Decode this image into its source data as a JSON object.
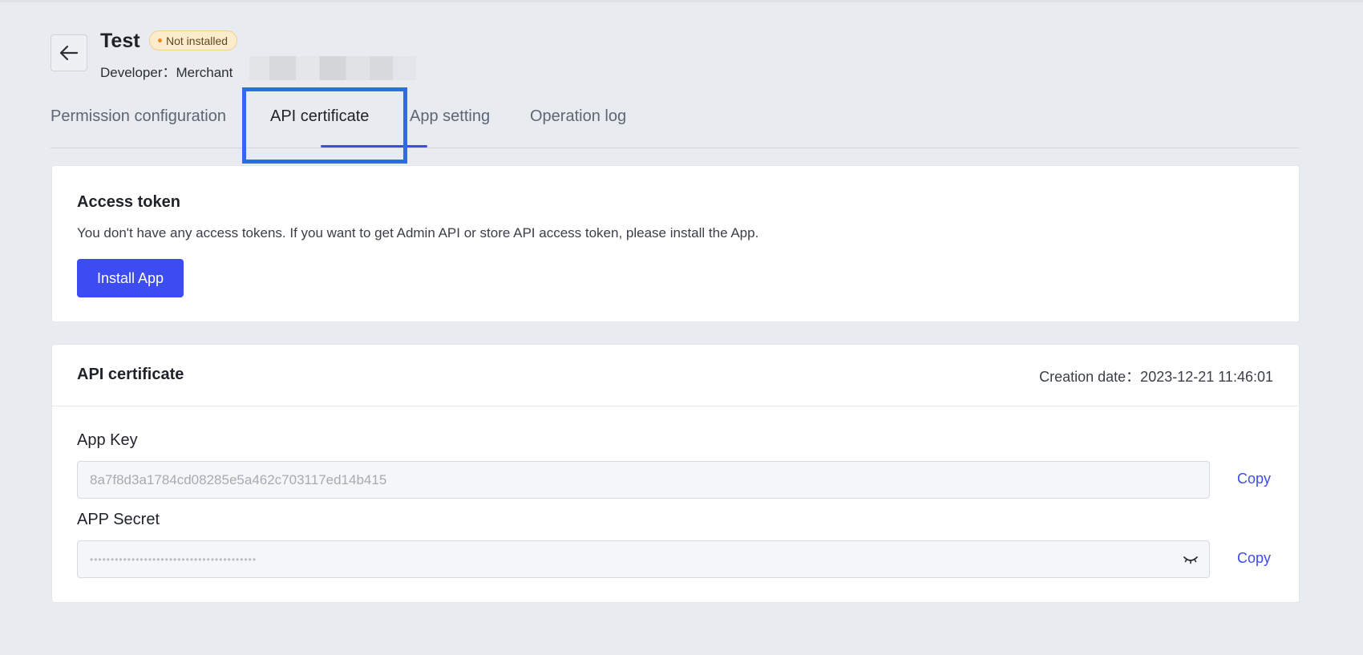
{
  "header": {
    "title": "Test",
    "status_badge": "Not installed",
    "developer_label": "Developer：Merchant"
  },
  "tabs": [
    {
      "label": "Permission configuration",
      "active": false
    },
    {
      "label": "API certificate",
      "active": true
    },
    {
      "label": "App setting",
      "active": false
    },
    {
      "label": "Operation log",
      "active": false
    }
  ],
  "access_token": {
    "title": "Access token",
    "description": "You don't have any access tokens. If you want to get Admin API or store API access token, please install the App.",
    "install_button": "Install App"
  },
  "api_certificate": {
    "title": "API certificate",
    "creation_date": "Creation date：2023-12-21 11:46:01",
    "app_key_label": "App Key",
    "app_key_value": "8a7f8d3a1784cd08285e5a462c703117ed14b415",
    "app_secret_label": "APP Secret",
    "app_secret_value": "••••••••••••••••••••••••••••••••••••••••",
    "copy_label": "Copy"
  },
  "colors": {
    "accent": "#3d4cf0",
    "highlight": "#2f6ae8",
    "badge_bg": "#fdeccb",
    "badge_dot": "#f08a1c"
  },
  "icons": {
    "back": "arrow-left-icon",
    "secret_toggle": "eye-closed-icon"
  }
}
